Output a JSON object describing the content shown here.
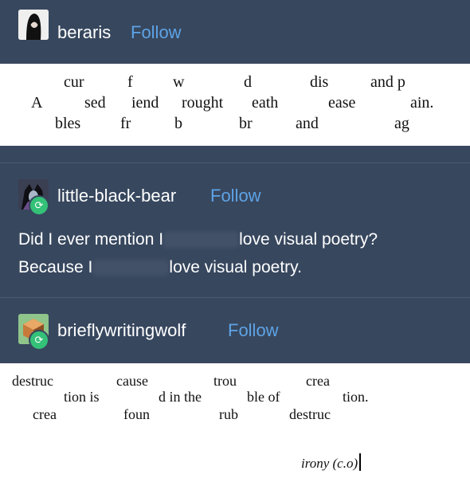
{
  "post1": {
    "username": "beraris",
    "follow": "Follow",
    "poem": {
      "top": [
        "cur",
        "f",
        "w",
        "d",
        "dis",
        "and p"
      ],
      "middle": [
        "A",
        "sed",
        "iend",
        "rought",
        "eath",
        "ease",
        "ain."
      ],
      "bottom": [
        "bles",
        "fr",
        "b",
        "br",
        "and",
        "ag"
      ]
    }
  },
  "post2": {
    "username": "little-black-bear",
    "follow": "Follow",
    "line1_a": "Did I ever mention I",
    "line1_b": "love visual poetry?",
    "line2_a": "Because I",
    "line2_b": "love visual poetry."
  },
  "post3": {
    "username": "brieflywritingwolf",
    "follow": "Follow",
    "poem": {
      "top": [
        "destruc",
        "cause",
        "trou",
        "crea"
      ],
      "middle": [
        "tion is",
        "d in the",
        "ble of",
        "tion."
      ],
      "bottom": [
        "crea",
        "foun",
        "rub",
        "destruc"
      ]
    },
    "signature": "irony (c.o)"
  },
  "colors": {
    "background": "#37475e",
    "follow": "#5ea3e6",
    "reblog": "#34c178"
  },
  "icons": [
    "avatar-beraris",
    "avatar-little-black-bear",
    "avatar-brieflywritingwolf",
    "reblog-icon"
  ]
}
